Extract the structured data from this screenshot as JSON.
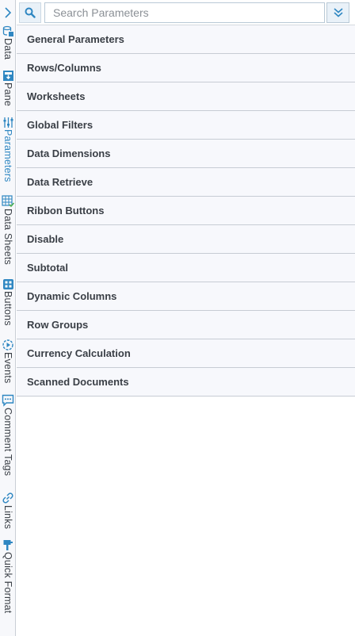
{
  "side_tabs": [
    {
      "label": "Data",
      "icon": "data-icon",
      "active": false
    },
    {
      "label": "Pane",
      "icon": "pane-icon",
      "active": false
    },
    {
      "label": "Parameters",
      "icon": "parameters-icon",
      "active": true
    },
    {
      "label": "Data Sheets",
      "icon": "data-sheets-icon",
      "active": false
    },
    {
      "label": "Buttons",
      "icon": "buttons-icon",
      "active": false
    },
    {
      "label": "Events",
      "icon": "events-icon",
      "active": false
    },
    {
      "label": "Comment Tags",
      "icon": "comment-tags-icon",
      "active": false
    },
    {
      "label": "Links",
      "icon": "links-icon",
      "active": false
    },
    {
      "label": "Quick Format",
      "icon": "quick-format-icon",
      "active": false
    }
  ],
  "search": {
    "placeholder": "Search Parameters",
    "value": ""
  },
  "sections": [
    {
      "label": "General Parameters"
    },
    {
      "label": "Rows/Columns"
    },
    {
      "label": "Worksheets"
    },
    {
      "label": "Global Filters"
    },
    {
      "label": "Data Dimensions"
    },
    {
      "label": "Data Retrieve"
    },
    {
      "label": "Ribbon Buttons"
    },
    {
      "label": "Disable"
    },
    {
      "label": "Subtotal"
    },
    {
      "label": "Dynamic Columns"
    },
    {
      "label": "Row Groups"
    },
    {
      "label": "Currency Calculation"
    },
    {
      "label": "Scanned Documents"
    }
  ],
  "colors": {
    "accent": "#2f87c2",
    "section_bg": "#f7f8fc",
    "section_border": "#c7ccd4",
    "text": "#3a3f46"
  }
}
